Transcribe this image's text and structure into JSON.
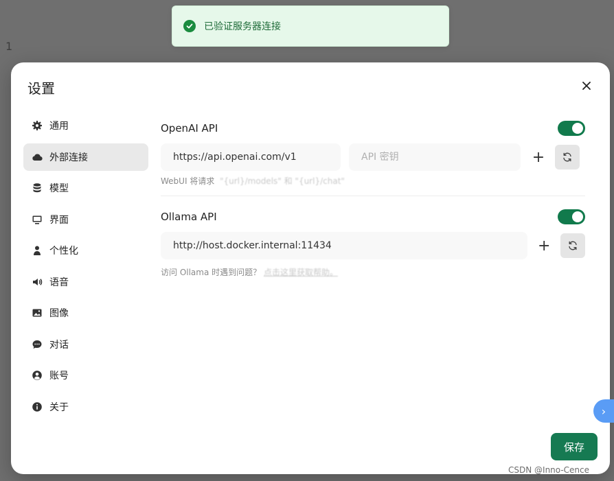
{
  "background": {
    "line_number": "1"
  },
  "toast": {
    "text": "已验证服务器连接",
    "color": "#1a8c3f"
  },
  "modal": {
    "title": "设置",
    "close_icon": "close-icon"
  },
  "sidebar": {
    "items": [
      {
        "label": "通用",
        "icon": "gear-icon"
      },
      {
        "label": "外部连接",
        "icon": "cloud-icon",
        "active": true
      },
      {
        "label": "模型",
        "icon": "database-icon"
      },
      {
        "label": "界面",
        "icon": "monitor-icon"
      },
      {
        "label": "个性化",
        "icon": "person-icon"
      },
      {
        "label": "语音",
        "icon": "speaker-icon"
      },
      {
        "label": "图像",
        "icon": "image-icon"
      },
      {
        "label": "对话",
        "icon": "chat-icon"
      },
      {
        "label": "账号",
        "icon": "user-circle-icon"
      },
      {
        "label": "关于",
        "icon": "info-icon"
      }
    ]
  },
  "openai": {
    "label": "OpenAI API",
    "enabled": true,
    "url_value": "https://api.openai.com/v1",
    "key_placeholder": "API 密钥",
    "hint_prefix": "WebUI 将请求",
    "add_label": "+"
  },
  "ollama": {
    "label": "Ollama API",
    "enabled": true,
    "url_value": "http://host.docker.internal:11434",
    "hint_prefix": "访问 Ollama 时遇到问题？",
    "hint_link": "点击这里获取帮助。",
    "add_label": "+"
  },
  "footer": {
    "save_label": "保存"
  },
  "overlay": {
    "chevron": "›",
    "watermark": "CSDN @Inno-Cence"
  },
  "colors": {
    "accent": "#117a4c",
    "save": "#167a52",
    "toast_bg": "#e6f8ea"
  }
}
